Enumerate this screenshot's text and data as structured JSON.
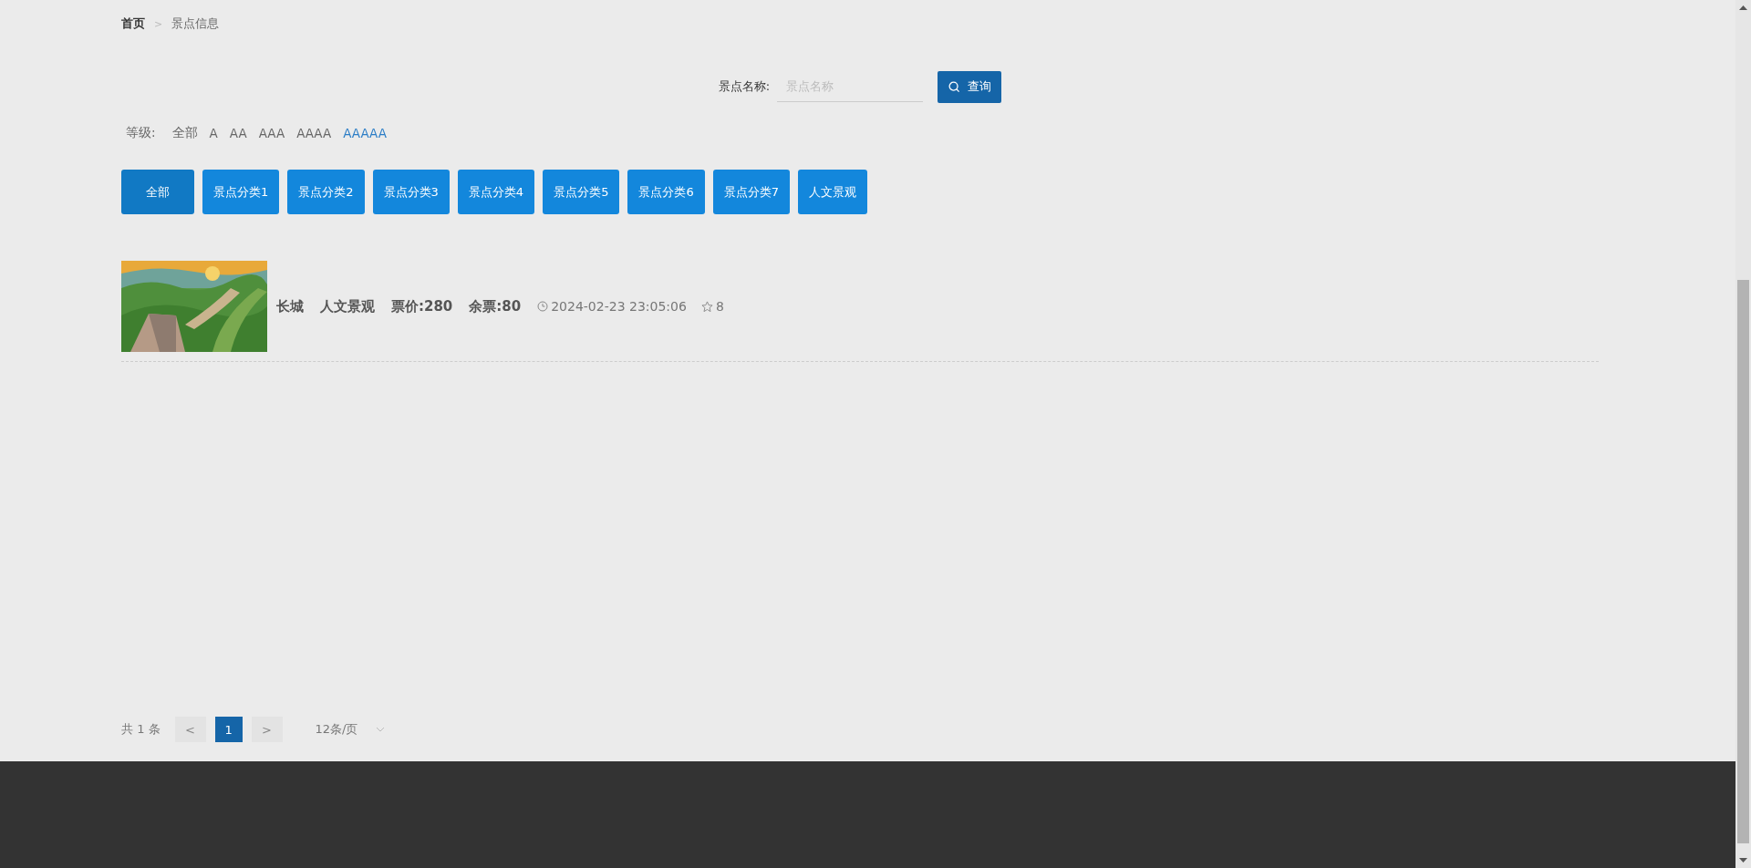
{
  "breadcrumb": [
    {
      "label": "首页",
      "current": false
    },
    {
      "label": "景点信息",
      "current": true
    }
  ],
  "breadcrumb_separator": ">",
  "search": {
    "label": "景点名称:",
    "placeholder": "景点名称",
    "button": "查询"
  },
  "level_filter": {
    "label": "等级:",
    "options": [
      {
        "label": "全部",
        "selected": false
      },
      {
        "label": "A",
        "selected": false
      },
      {
        "label": "AA",
        "selected": false
      },
      {
        "label": "AAA",
        "selected": false
      },
      {
        "label": "AAAA",
        "selected": false
      },
      {
        "label": "AAAAA",
        "selected": true
      }
    ]
  },
  "categories": [
    {
      "label": "全部",
      "selected": true
    },
    {
      "label": "景点分类1",
      "selected": false
    },
    {
      "label": "景点分类2",
      "selected": false
    },
    {
      "label": "景点分类3",
      "selected": false
    },
    {
      "label": "景点分类4",
      "selected": false
    },
    {
      "label": "景点分类5",
      "selected": false
    },
    {
      "label": "景点分类6",
      "selected": false
    },
    {
      "label": "景点分类7",
      "selected": false
    },
    {
      "label": "人文景观",
      "selected": false
    }
  ],
  "items": [
    {
      "kind": "picture",
      "name": "长城",
      "category": "人文景观",
      "price": "票价:280",
      "remaining": "余票:80",
      "time": "2024-02-23 23:05:06",
      "favorites": "8"
    }
  ],
  "pagination": {
    "total": "共 1 条",
    "prev": "<",
    "pages": [
      {
        "label": "1",
        "selected": true
      }
    ],
    "next": ">",
    "page_size": "12条/页"
  }
}
